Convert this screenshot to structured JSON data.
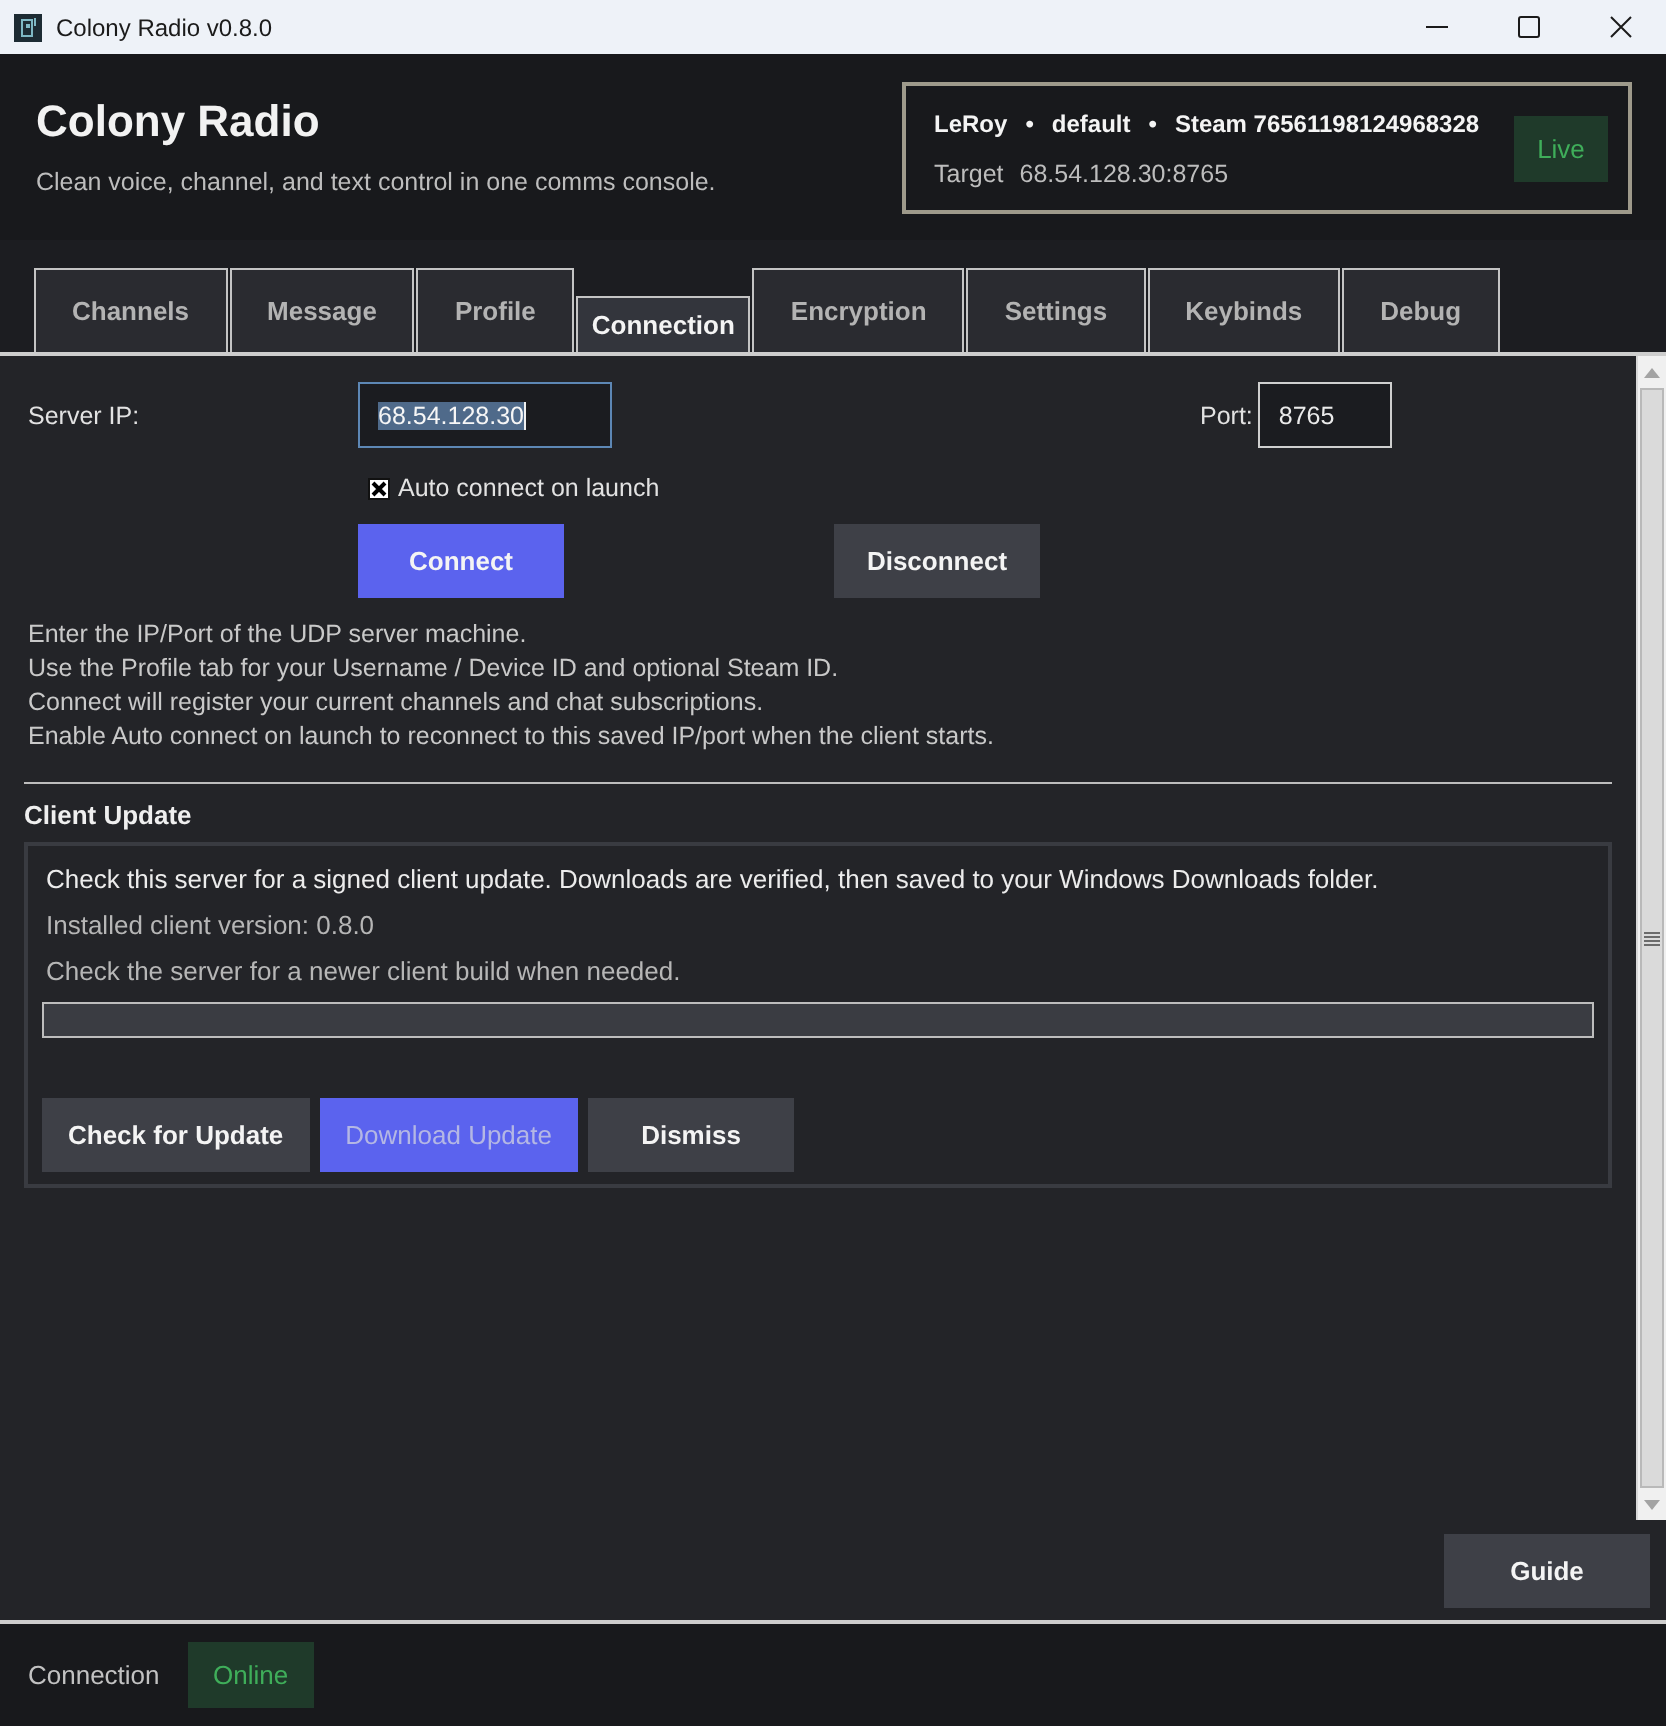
{
  "window": {
    "title": "Colony Radio v0.8.0"
  },
  "header": {
    "title": "Colony Radio",
    "subtitle": "Clean voice, channel, and text control in one comms console.",
    "session": {
      "identity": [
        {
          "kind": "value",
          "text": "LeRoy"
        },
        {
          "kind": "separator",
          "text": "•"
        },
        {
          "kind": "value",
          "text": "default"
        },
        {
          "kind": "separator",
          "text": "•"
        },
        {
          "kind": "value",
          "text": "Steam 76561198124968328"
        }
      ],
      "target_label": "Target",
      "target": "68.54.128.30:8765",
      "badge": "Live"
    }
  },
  "tabs": [
    {
      "label": "Channels",
      "selected": false
    },
    {
      "label": "Message",
      "selected": false
    },
    {
      "label": "Profile",
      "selected": false
    },
    {
      "label": "Connection",
      "selected": true
    },
    {
      "label": "Encryption",
      "selected": false
    },
    {
      "label": "Settings",
      "selected": false
    },
    {
      "label": "Keybinds",
      "selected": false
    },
    {
      "label": "Debug",
      "selected": false
    }
  ],
  "connection": {
    "server_ip": {
      "label": "Server IP:",
      "value": "68.54.128.30",
      "focused": true
    },
    "port": {
      "label": "Port:",
      "value": "8765",
      "focused": false
    },
    "auto_connect": {
      "label": "Auto connect on launch",
      "checked": true
    },
    "buttons": [
      {
        "label": "Connect",
        "kind": "primary",
        "disabled": false
      },
      {
        "label": "Disconnect",
        "kind": "secondary",
        "disabled": false
      }
    ],
    "help": [
      "Enter the IP/Port of the UDP server machine.",
      "Use the Profile tab for your Username / Device ID and optional Steam ID.",
      "Connect will register your current channels and chat subscriptions.",
      "Enable Auto connect on launch to reconnect to this saved IP/port when the client starts."
    ]
  },
  "client_update": {
    "title": "Client Update",
    "description": "Check this server for a signed client update. Downloads are verified, then saved to your Windows Downloads folder.",
    "version": "Installed client version: 0.8.0",
    "hint": "Check the server for a newer client build when needed.",
    "progress": {
      "level": 0
    },
    "buttons": [
      {
        "label": "Check for Update",
        "kind": "secondary",
        "disabled": false
      },
      {
        "label": "Download Update",
        "kind": "primary",
        "disabled": true
      },
      {
        "label": "Dismiss",
        "kind": "secondary",
        "disabled": false
      }
    ]
  },
  "guide_button": {
    "label": "Guide"
  },
  "status_bar": {
    "label": "Connection",
    "badge": "Online"
  }
}
